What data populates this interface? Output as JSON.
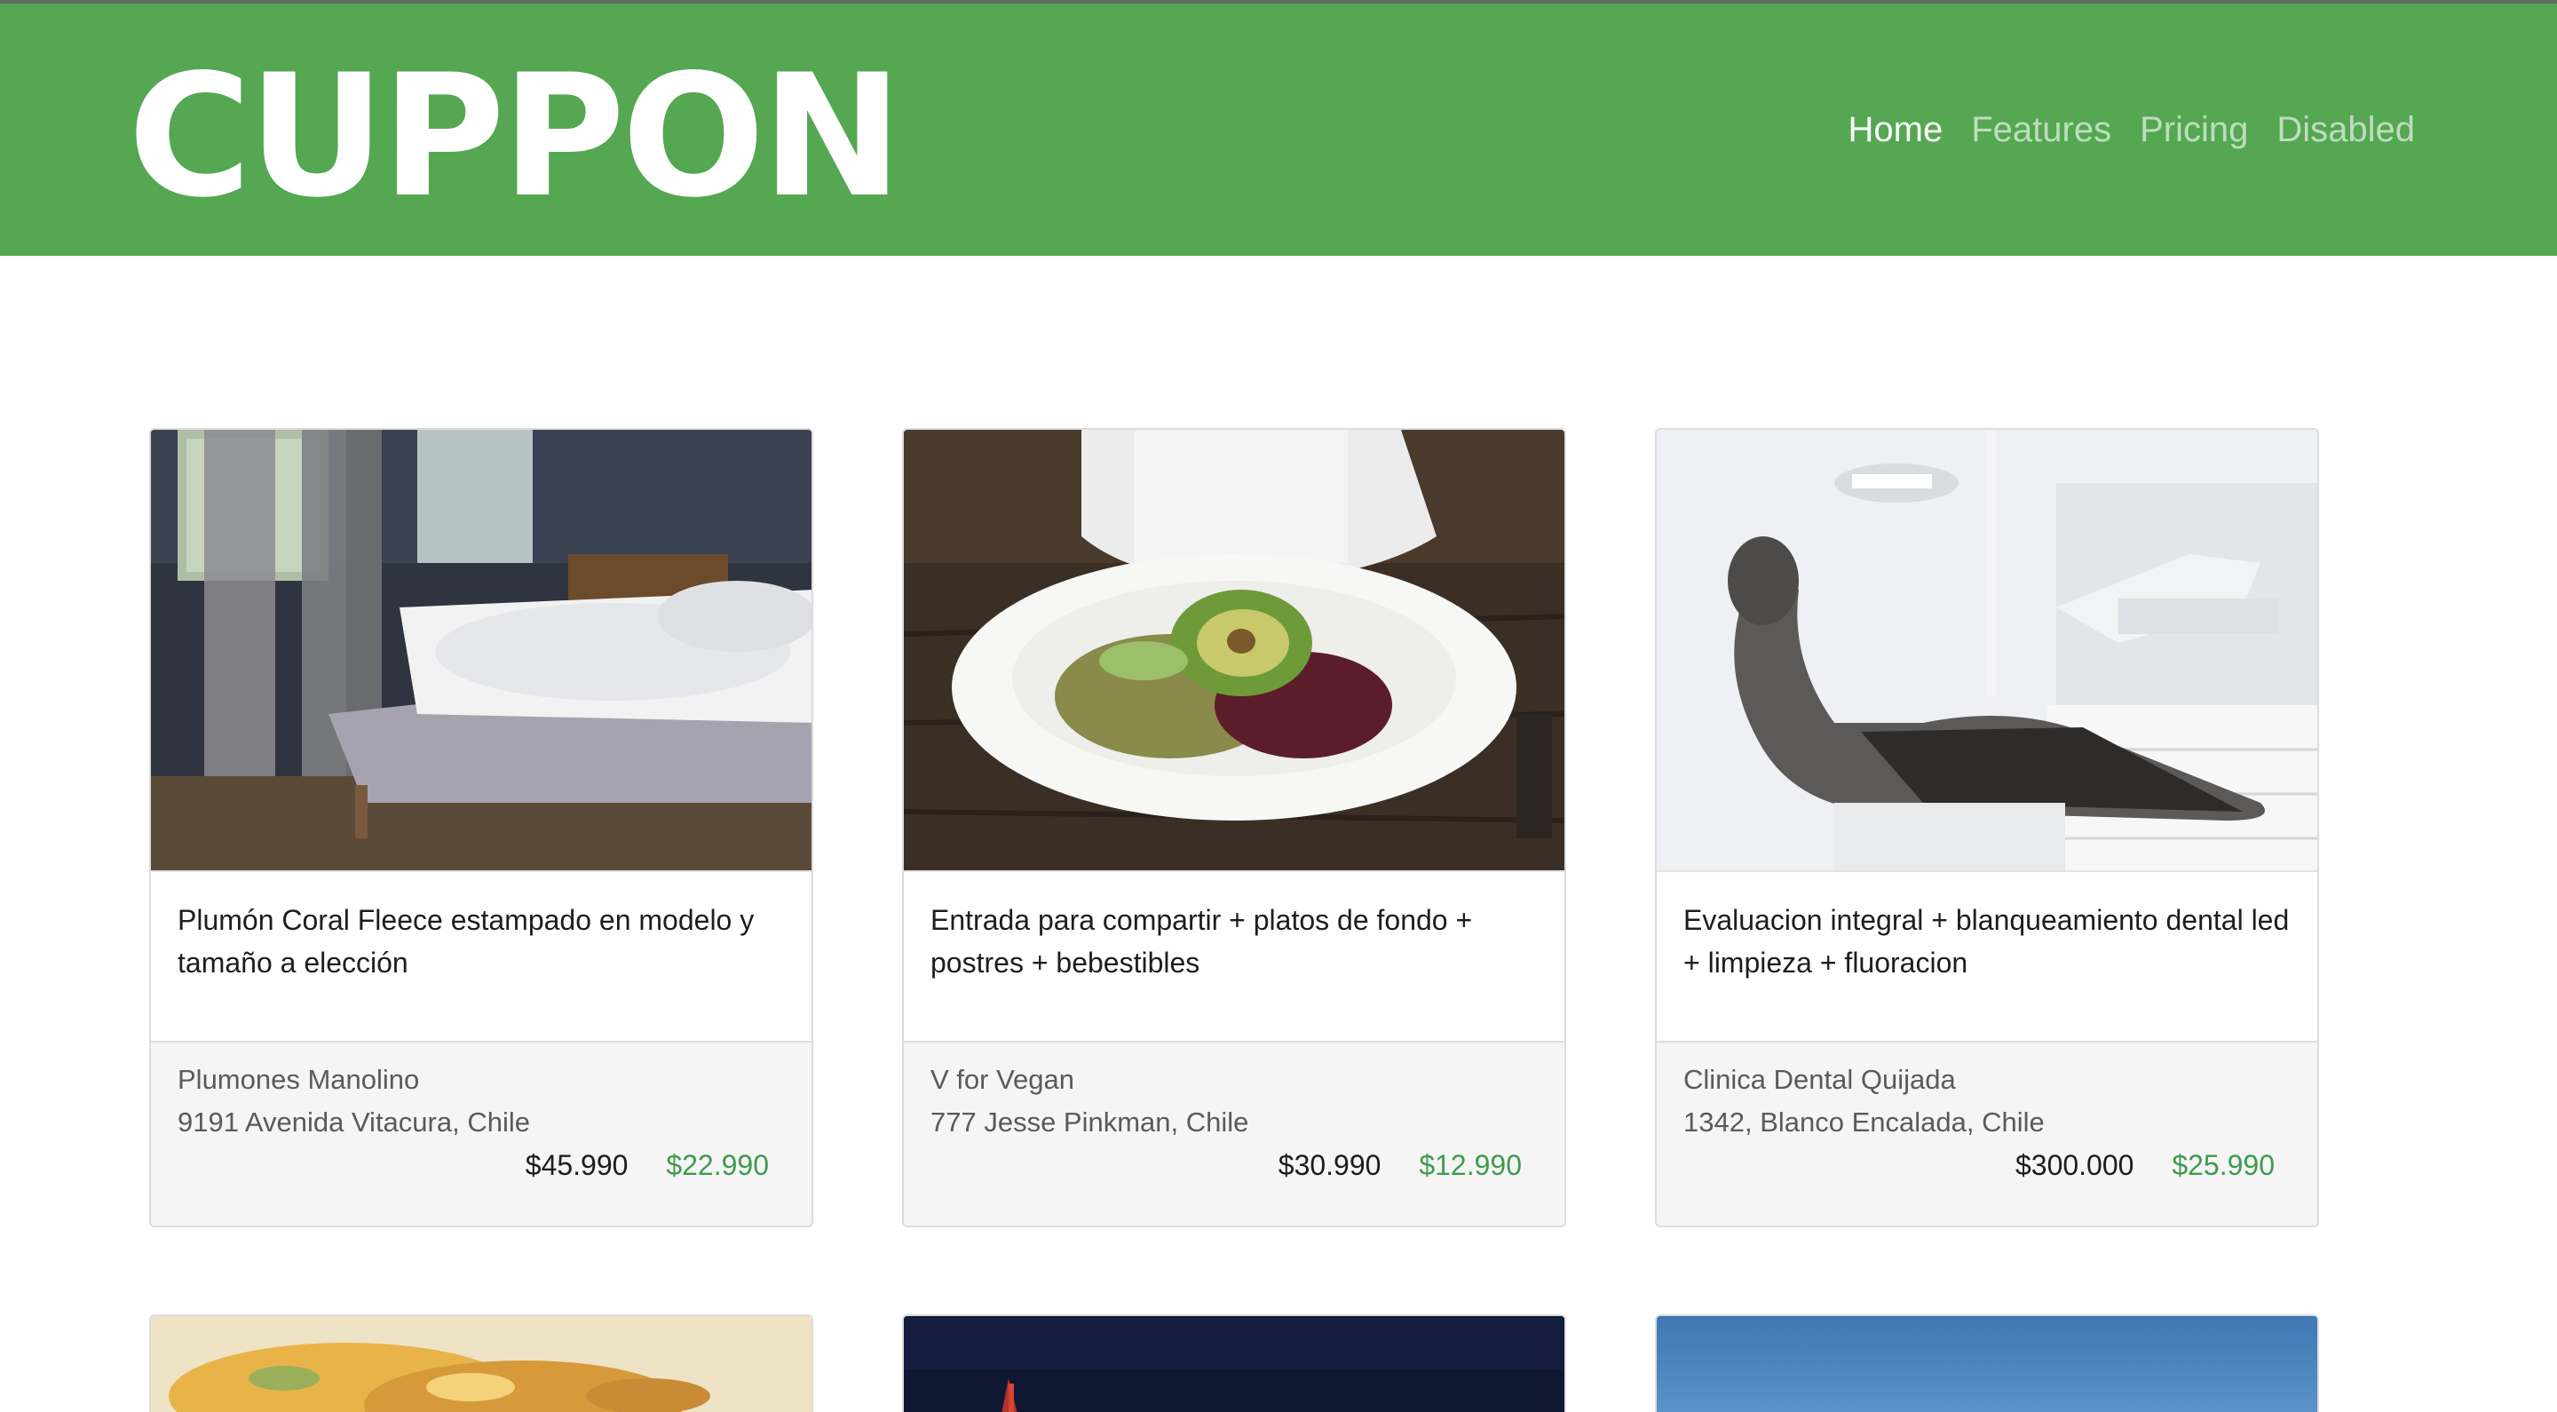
{
  "header": {
    "brand": "CUPPON",
    "nav": [
      {
        "label": "Home",
        "active": true
      },
      {
        "label": "Features",
        "active": false
      },
      {
        "label": "Pricing",
        "active": false
      },
      {
        "label": "Disabled",
        "active": false
      }
    ]
  },
  "colors": {
    "navbar": "#55a752",
    "new_price": "#3f9a4e",
    "footer_bg": "#f5f5f5"
  },
  "cards": [
    {
      "image": "bedroom-photo",
      "title": "Plumón Coral Fleece estampado en modelo y tamaño a elección",
      "vendor": "Plumones Manolino",
      "address": "9191 Avenida Vitacura, Chile",
      "old_price": "$45.990",
      "new_price": "$22.990"
    },
    {
      "image": "vegan-salad-photo",
      "title": "Entrada para compartir + platos de fondo + postres + bebestibles",
      "vendor": "V for Vegan",
      "address": "777 Jesse Pinkman, Chile",
      "old_price": "$30.990",
      "new_price": "$12.990"
    },
    {
      "image": "dental-chair-photo",
      "title": "Evaluacion integral + blanqueamiento dental led + limpieza + fluoracion",
      "vendor": "Clinica Dental Quijada",
      "address": "1342, Blanco Encalada, Chile",
      "old_price": "$300.000",
      "new_price": "$25.990"
    }
  ],
  "peek_cards": [
    {
      "image": "pasta-dish-photo"
    },
    {
      "image": "night-scene-photo"
    },
    {
      "image": "blue-sky-photo"
    }
  ]
}
